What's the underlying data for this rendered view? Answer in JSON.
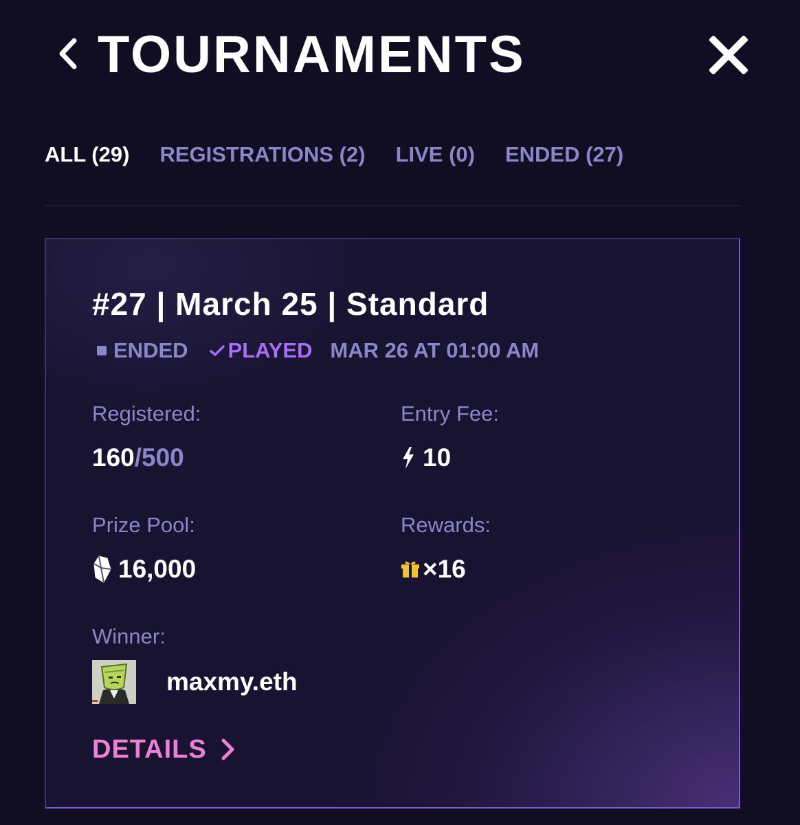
{
  "header": {
    "title": "TOURNAMENTS"
  },
  "tabs": [
    {
      "label": "ALL (29)",
      "active": true
    },
    {
      "label": "REGISTRATIONS (2)",
      "active": false
    },
    {
      "label": "LIVE (0)",
      "active": false
    },
    {
      "label": "ENDED (27)",
      "active": false
    }
  ],
  "card": {
    "title": "#27 | March 25 | Standard",
    "status": "ENDED",
    "played": "PLAYED",
    "date": "MAR 26 AT 01:00 AM",
    "registered_label": "Registered:",
    "registered_count": "160",
    "registered_max": "/500",
    "entry_fee_label": "Entry Fee:",
    "entry_fee_value": "10",
    "prize_pool_label": "Prize Pool:",
    "prize_pool_value": "16,000",
    "rewards_label": "Rewards:",
    "rewards_value": "×16",
    "winner_label": "Winner:",
    "winner_name": "maxmy.eth",
    "details_label": "DETAILS"
  },
  "colors": {
    "background": "#110d22",
    "muted_text": "#8a86c8",
    "played_purple": "#a86ef5",
    "details_pink": "#ee7fd6",
    "gift_yellow": "#f2c233"
  },
  "icons": {
    "back": "chevron-left-icon",
    "close": "close-icon",
    "status": "square-icon",
    "played": "checkmark-icon",
    "entry_fee": "lightning-icon",
    "prize_pool": "crystal-icon",
    "rewards": "gift-icon",
    "details": "chevron-right-icon"
  }
}
